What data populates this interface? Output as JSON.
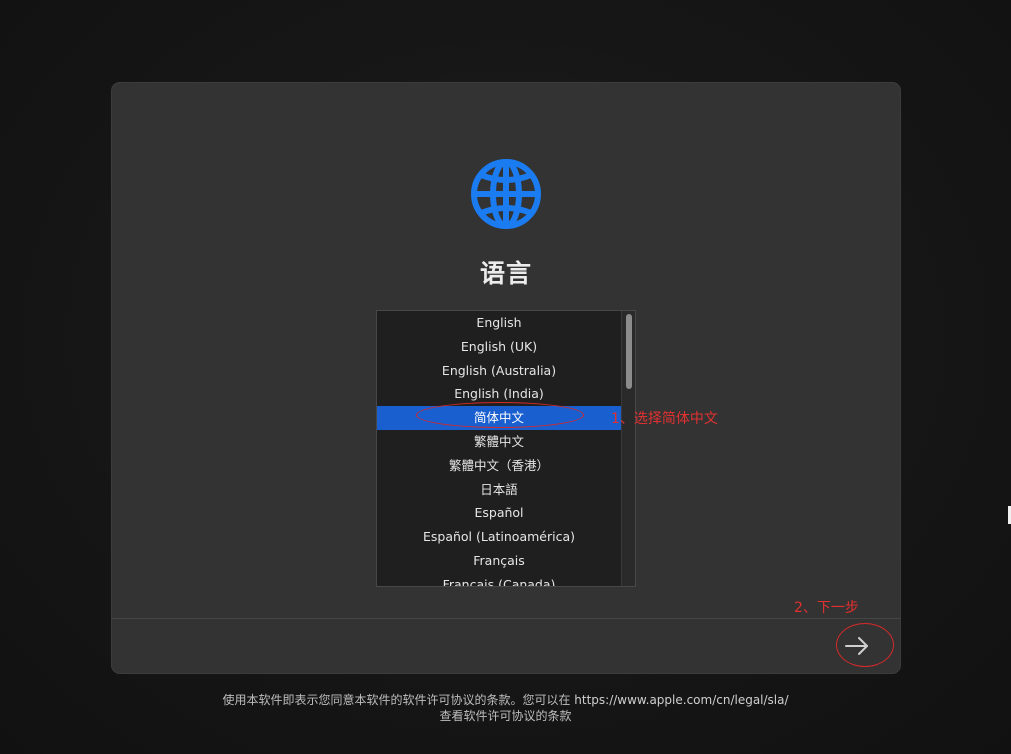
{
  "colors": {
    "accent_blue": "#1a5fd0",
    "globe_blue": "#1a7cf0",
    "annotation_red": "#e23030"
  },
  "title": "语言",
  "languages": [
    "English",
    "English (UK)",
    "English (Australia)",
    "English (India)",
    "简体中文",
    "繁體中文",
    "繁體中文（香港）",
    "日本語",
    "Español",
    "Español (Latinoamérica)",
    "Français",
    "Français (Canada)"
  ],
  "selected_language": "简体中文",
  "icons": {
    "globe": "globe-icon",
    "next": "arrow-right-icon"
  },
  "annotations": {
    "step1": "1、选择简体中文",
    "step2": "2、下一步"
  },
  "license": {
    "line1_prefix": "使用本软件即表示您同意本软件的软件许可协议的条款。您可以在 ",
    "url": "https://www.apple.com/cn/legal/sla/",
    "line2": "查看软件许可协议的条款"
  }
}
